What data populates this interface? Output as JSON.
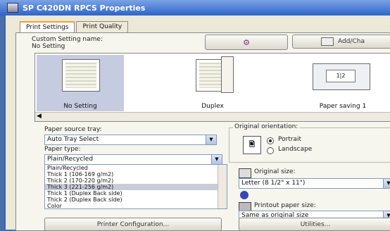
{
  "window": {
    "title": "SP C420DN  RPCS Properties"
  },
  "tabs": [
    {
      "label": "Print Settings"
    },
    {
      "label": "Print Quality"
    }
  ],
  "custom_setting": {
    "label": "Custom Setting name:",
    "value": "No Setting",
    "add_button": "Add/Cha"
  },
  "presets": [
    {
      "label": "No Setting"
    },
    {
      "label": "Duplex"
    },
    {
      "label": "Paper saving 1"
    }
  ],
  "paper_source": {
    "label": "Paper source tray:",
    "value": "Auto Tray Select"
  },
  "paper_type": {
    "label": "Paper type:",
    "value": "Plain/Recycled",
    "options": [
      "Plain/Recycled",
      "Thick 1 (106-169 g/m2)",
      "Thick 2 (170-220 g/m2)",
      "Thick 3 (221-256 g/m2)",
      "Thick 1 (Duplex Back side)",
      "Thick 2 (Duplex Back side)",
      "Color"
    ],
    "selected_index": 3
  },
  "orientation": {
    "label": "Original orientation:",
    "portrait": "Portrait",
    "landscape": "Landscape",
    "selected": "portrait"
  },
  "original_size": {
    "label": "Original size:",
    "value": "Letter (8 1/2\" x 11\")"
  },
  "printout_size": {
    "label": "Printout paper size:",
    "value": "Same as original size"
  },
  "buttons": {
    "printer_config": "Printer Configuration...",
    "utilities": "Utilities..."
  }
}
